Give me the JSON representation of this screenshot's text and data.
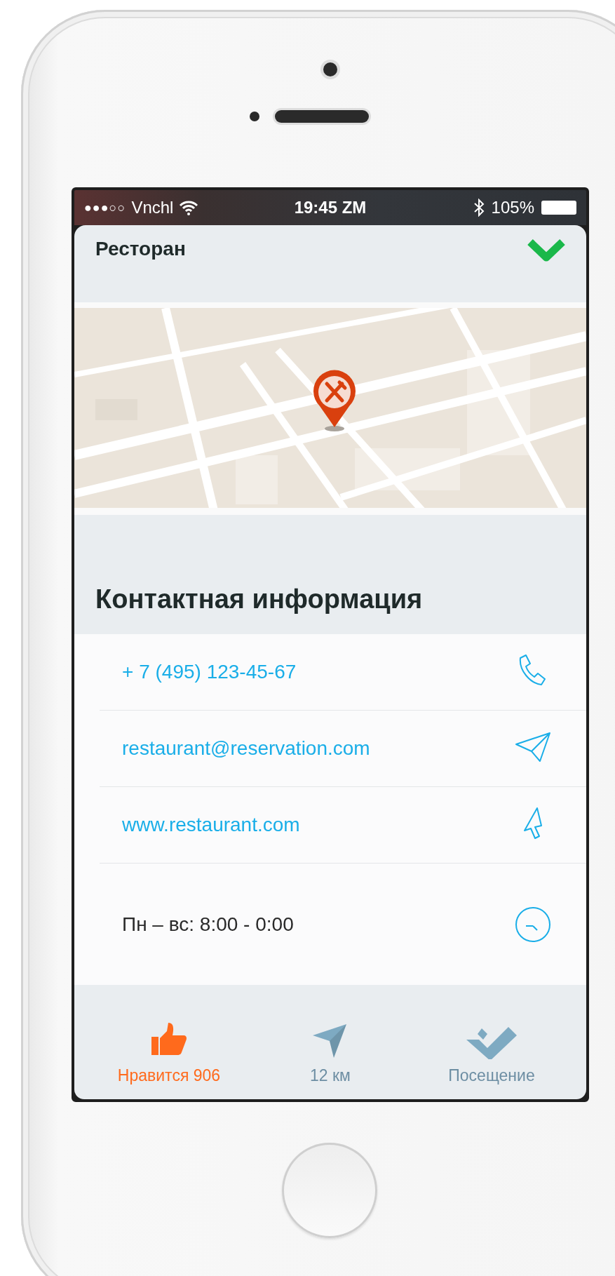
{
  "status_bar": {
    "signal": "●●●○○",
    "carrier": "Vnchl",
    "time": "19:45 ZM",
    "battery": "105%"
  },
  "header": {
    "title": "Ресторан"
  },
  "contacts": {
    "heading": "Контактная информация",
    "items": [
      {
        "kind": "phone",
        "text": "+ 7 (495) 123-45-67"
      },
      {
        "kind": "email",
        "text": "restaurant@reservation.com"
      },
      {
        "kind": "web",
        "text": "www.restaurant.com"
      },
      {
        "kind": "hours",
        "text": "Пн – вс: 8:00 - 0:00"
      }
    ]
  },
  "tab_bar": [
    {
      "kind": "like",
      "label": "Нравится 906",
      "selected": true
    },
    {
      "kind": "distance",
      "label": "12 км",
      "selected": false
    },
    {
      "kind": "visit",
      "label": "Посещение",
      "selected": false
    }
  ]
}
